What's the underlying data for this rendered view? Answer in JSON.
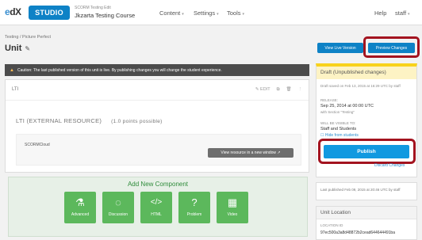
{
  "header": {
    "logo_text": "edX",
    "studio_label": "STUDIO",
    "course_org": "SCORM Testing Edit",
    "course_title": "Jkzarta Testing Course",
    "nav": [
      {
        "label": "Content"
      },
      {
        "label": "Settings"
      },
      {
        "label": "Tools"
      }
    ],
    "help": "Help",
    "user": "staff"
  },
  "breadcrumb": "Testing / Picture Perfect",
  "unit_title": "Unit",
  "caution": "Caution: The last published version of this unit is live. By publishing changes you will change the student experience.",
  "component": {
    "type_label": "LTI",
    "edit_label": "EDIT",
    "xblock_title": "LTI (EXTERNAL RESOURCE)",
    "points": "(1.0 points possible)",
    "provider": "SCORMCloud",
    "view_button": "View resource in a new window"
  },
  "add_component": {
    "title": "Add New Component",
    "items": [
      {
        "label": "Advanced",
        "icon": "flask-icon",
        "glyph": "⚗"
      },
      {
        "label": "Discussion",
        "icon": "speech-bubble-icon",
        "glyph": "◌"
      },
      {
        "label": "HTML",
        "icon": "code-icon",
        "glyph": "</>"
      },
      {
        "label": "Problem",
        "icon": "question-circle-icon",
        "glyph": "?"
      },
      {
        "label": "Video",
        "icon": "film-icon",
        "glyph": "▦"
      }
    ]
  },
  "sidebar": {
    "view_live": "View Live Version",
    "preview": "Preview Changes",
    "draft_title": "Draft (Unpublished changes)",
    "draft_saved": "Draft saved on Feb 13, 2015 at 16:29 UTC by staff",
    "release_label": "RELEASE:",
    "release_value": "Sep 25, 2014 at 00:00 UTC",
    "release_section": "with Section \"Testing\"",
    "visible_label": "WILL BE VISIBLE TO:",
    "visible_value": "Staff and Students",
    "hide_label": "Hide from students",
    "publish": "Publish",
    "discard": "Discard Changes",
    "last_published": "Last published Feb 09, 2015 at 20:46 UTC by staff",
    "location_title": "Unit Location",
    "location_id_label": "LOCATION ID",
    "location_id": "97ec500a3a8d48872b2cead644644491ba"
  },
  "colors": {
    "accent": "#0e82c6",
    "green": "#5cb85c",
    "highlight": "#a3131f",
    "draft": "#f8d21b"
  }
}
